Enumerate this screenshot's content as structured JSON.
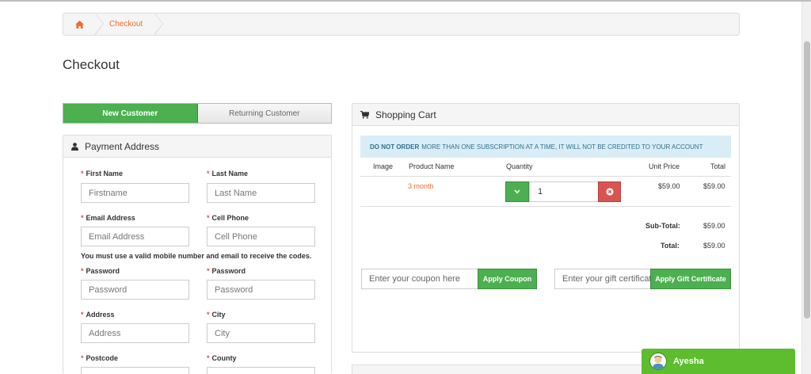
{
  "breadcrumb": {
    "home_icon": "home-icon",
    "current": "Checkout"
  },
  "page_title": "Checkout",
  "tabs": {
    "new_customer": "New Customer",
    "returning_customer": "Returning Customer"
  },
  "payment": {
    "title": "Payment Address",
    "required_mark": "*",
    "first_name": {
      "label": "First Name",
      "placeholder": "Firstname"
    },
    "last_name": {
      "label": "Last Name",
      "placeholder": "Last Name"
    },
    "email": {
      "label": "Email Address",
      "placeholder": "Email Address"
    },
    "cell_phone": {
      "label": "Cell Phone",
      "placeholder": "Cell Phone"
    },
    "notice": "You must use a valid mobile number and email to receive the codes.",
    "password": {
      "label": "Password",
      "placeholder": "Password"
    },
    "password_confirm": {
      "label": "Password",
      "placeholder": "Password"
    },
    "address": {
      "label": "Address",
      "placeholder": "Address"
    },
    "city": {
      "label": "City",
      "placeholder": "City"
    },
    "postcode": {
      "label": "Postcode"
    },
    "county": {
      "label": "County"
    }
  },
  "cart": {
    "title": "Shopping Cart",
    "alert_strong": "DO NOT ORDER",
    "alert_rest": "MORE THAN ONE SUBSCRIPTION AT A TIME, IT WILL NOT BE CREDITED TO YOUR ACCOUNT",
    "columns": {
      "image": "Image",
      "product_name": "Product Name",
      "quantity": "Quantity",
      "unit_price": "Unit Price",
      "total": "Total"
    },
    "item": {
      "name": "3 month",
      "quantity": "1",
      "unit_price": "$59.00",
      "total": "$59.00"
    },
    "subtotal_label": "Sub-Total:",
    "subtotal_value": "$59.00",
    "total_label": "Total:",
    "total_value": "$59.00",
    "coupon_placeholder": "Enter your coupon here",
    "apply_coupon": "Apply Coupon",
    "gift_placeholder": "Enter your gift certificate",
    "apply_gift": "Apply Gift Certificate"
  },
  "chat": {
    "name": "Ayesha"
  },
  "colors": {
    "accent_green": "#4caf50",
    "link_orange": "#f36a2b",
    "danger_red": "#d9534f",
    "alert_bg": "#d9edf7"
  }
}
